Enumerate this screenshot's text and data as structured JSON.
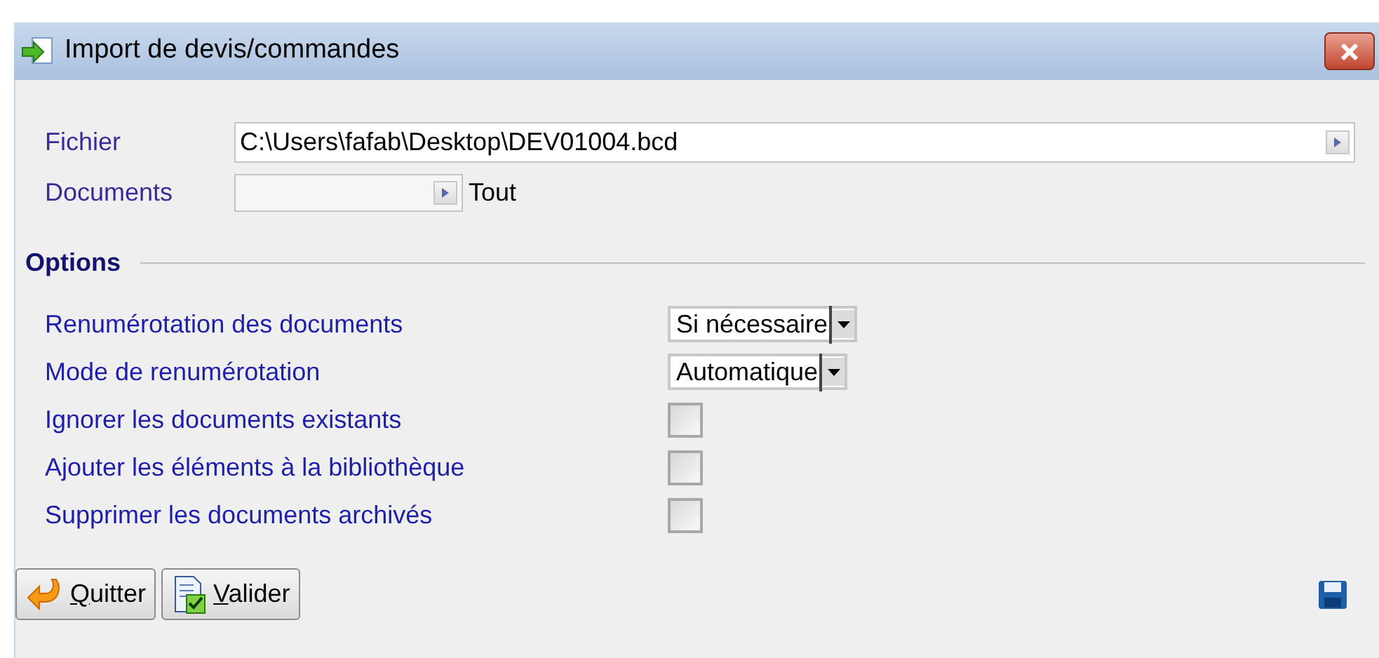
{
  "window": {
    "title": "Import de devis/commandes"
  },
  "fields": [
    {
      "label": "Fichier",
      "value": "C:\\Users\\fafab\\Desktop\\DEV01004.bcd"
    },
    {
      "label": "Documents",
      "suffix": "Tout"
    }
  ],
  "options": {
    "title": "Options",
    "rows": [
      {
        "kind": "select",
        "label": "Renumérotation des documents",
        "value": "Si nécessaire"
      },
      {
        "kind": "select",
        "label": "Mode de renumérotation",
        "value": "Automatique"
      },
      {
        "kind": "checkbox",
        "label": "Ignorer les documents existants",
        "checked": false
      },
      {
        "kind": "checkbox",
        "label": "Ajouter les éléments à la bibliothèque",
        "checked": false
      },
      {
        "kind": "checkbox",
        "label": "Supprimer les documents archivés",
        "checked": false
      }
    ]
  },
  "buttons": [
    {
      "kind": "quit",
      "label": "Quitter"
    },
    {
      "kind": "validate",
      "label": "Valider"
    }
  ]
}
